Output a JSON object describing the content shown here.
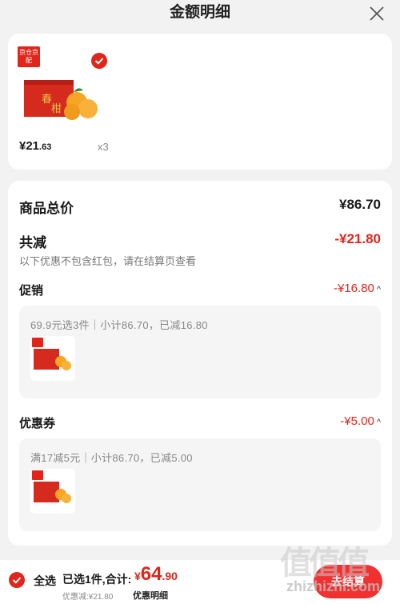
{
  "header": {
    "title": "金额明细",
    "close_icon": "close-icon"
  },
  "product": {
    "store_tag": "京仓京配",
    "selected": true,
    "price_int": "¥21",
    "price_dec": ".63",
    "quantity": "x3"
  },
  "summary": {
    "total_label": "商品总价",
    "total_value": "¥86.70",
    "discount_label": "共减",
    "discount_value": "-¥21.80",
    "discount_note": "以下优惠不包含红包，请在结算页查看"
  },
  "promo": {
    "label": "促销",
    "value": "-¥16.80",
    "detail": "69.9元选3件｜小计86.70，已减16.80"
  },
  "coupon": {
    "label": "优惠券",
    "value": "-¥5.00",
    "detail": "满17减5元｜小计86.70，已减5.00"
  },
  "footer": {
    "select_all": "全选",
    "chosen": "已选1件,合计:",
    "total_cur": "¥",
    "total_int": "64",
    "total_dec": ".90",
    "saved": "优惠减:¥21.80",
    "detail_link": "优惠明细",
    "checkout": "去结算"
  },
  "watermark": {
    "logo": "值值值",
    "text": "zhizhizhi.com"
  },
  "colors": {
    "accent": "#e1251b",
    "background": "#f2f2f2"
  }
}
